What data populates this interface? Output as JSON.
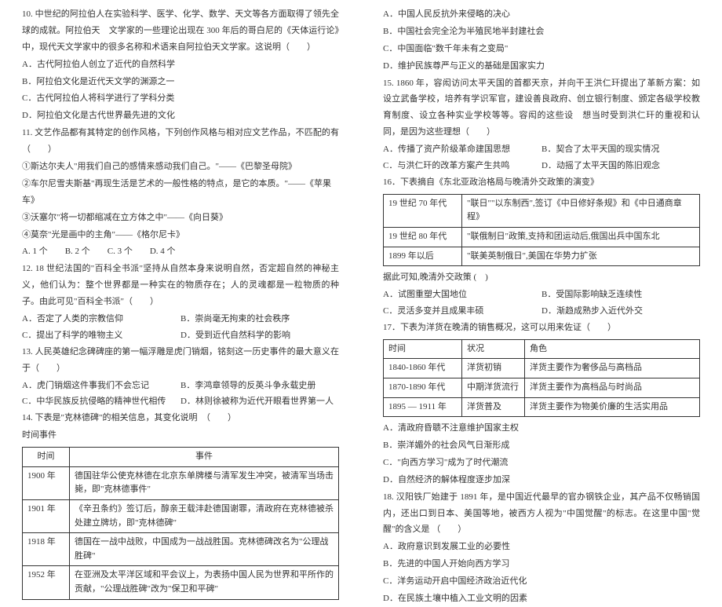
{
  "left": {
    "q10": {
      "stem": "10. 中世纪的阿拉伯人在实验科学、医学、化学、数学、天文等各方面取得了领先全球的成就。阿拉伯天　文学家的一些理论出现在 300 年后的哥白尼的《天体运行论》中，现代天文学家中的很多名称和术语来自阿拉伯天文学家。这说明（　　）",
      "a": "A．古代阿拉伯人创立了近代的自然科学",
      "b": "B．阿拉伯文化是近代天文学的渊源之一",
      "c": "C．古代阿拉伯人将科学进行了学科分类",
      "d": "D．阿拉伯文化是古代世界最先进的文化"
    },
    "q11": {
      "stem": "11. 文艺作品都有其特定的创作风格，下列创作风格与相对应文艺作品，不匹配的有（　　）",
      "i1": "①斯达尔夫人\"用我们自己的感情来感动我们自己。\"——《巴黎圣母院》",
      "i2": "②车尔尼雪夫斯基\"再现生活是艺术的一般性格的特点，是它的本质。\"——《苹果车》",
      "i3": "③沃塞尔\"将一切都缩减在立方体之中\"——《向日葵》",
      "i4": "④莫奈\"光是画中的主角\"——《格尔尼卡》",
      "choices": "A. 1 个　　B. 2 个　　C. 3 个　　D. 4 个"
    },
    "q12": {
      "stem": "12. 18 世纪法国的\"百科全书派\"坚持从自然本身来说明自然，否定超自然的神秘主义，他们认为：整个世界都是一种实在的物质存在；人的灵魂都是一粒物质的种子。由此可见\"百科全书派\"（　　）",
      "a": "A．否定了人类的宗教信仰",
      "b": "B．崇尚毫无拘束的社会秩序",
      "c": "C．提出了科学的唯物主义",
      "d": "D．受到近代自然科学的影响"
    },
    "q13": {
      "stem": "13. 人民英雄纪念碑碑座的第一幅浮雕是虎门销烟，铭刻这一历史事件的最大意义在于（　　）",
      "a": "A．虎门销烟这件事我们不会忘记",
      "b": "B．李鸿章领导的反英斗争永载史册",
      "c": "C．中华民族反抗侵略的精神世代相传",
      "d": "D．林则徐被称为近代开眼看世界第一人"
    },
    "q14": {
      "stem": "14. 下表是\"克林德碑\"的相关信息，其变化说明　（　　）",
      "pre": "时间事件",
      "table": {
        "head": [
          "时间",
          "事件"
        ],
        "rows": [
          [
            "1900 年",
            "德国驻华公使克林德在北京东单牌楼与清军发生冲突，被清军当场击毙，即\"克林德事件\""
          ],
          [
            "1901 年",
            "《辛丑条约》签订后，醇亲王载沣赴德国谢罪，清政府在克林德被杀处建立牌坊，即\"克林德碑\""
          ],
          [
            "1918 年",
            "德国在一战中战败，中国成为一战战胜国。克林德碑改名为\"公理战胜碑\""
          ],
          [
            "1952 年",
            "在亚洲及太平洋区域和平会议上，为表扬中国人民为世界和平所作的贡献，\"公理战胜碑\"改为\"保卫和平碑\""
          ]
        ]
      }
    }
  },
  "right": {
    "q14_choices": {
      "a": "A．中国人民反抗外来侵略的决心",
      "b": "B．中国社会完全沦为半殖民地半封建社会",
      "c": "C．中国面临\"数千年未有之变局\"",
      "d": "D．维护民族尊严与正义的基础是国家实力"
    },
    "q15": {
      "stem": "15. 1860 年，容闳访问太平天国的首都天京，并向干王洪仁玕提出了革新方案：如设立武备学校，培养有学识军官，建设善良政府、创立银行制度、颁定各级学校教育制度、设立各种实业学校等等。容闳的这些设　想当时受到洪仁玕的重视和认同，是因为这些理想（　　）",
      "a": "A．传播了资产阶级革命建国思想",
      "b": "B．契合了太平天国的现实情况",
      "c": "C．与洪仁玕的改革方案产生共鸣",
      "d": "D．动摇了太平天国的陈旧观念"
    },
    "q16": {
      "stem": "16．下表摘自《东北亚政治格局与晚清外交政策的演变》",
      "table": {
        "rows": [
          [
            "19 世纪 70 年代",
            "\"联日\"\"以东制西\",签订《中日修好条规》和《中日通商章程》"
          ],
          [
            "19 世纪 80 年代",
            "\"联俄制日\"政策,支持和团运动后,俄国出兵中国东北"
          ],
          [
            "1899 年以后",
            "\"联美英制俄日\",美国在华势力扩张"
          ]
        ]
      },
      "post": "据此可知,晚清外交政策 (　)",
      "a": "A．试图重塑大国地位",
      "b": "B．受国际影响缺乏连续性",
      "c": "C．灵活多变并且成果丰硕",
      "d": "D．渐趋成熟步入近代外交"
    },
    "q17": {
      "stem": "17．下表为洋货在晚清的销售概况，这可以用来佐证（　　）",
      "table": {
        "head": [
          "时间",
          "状况",
          "角色"
        ],
        "rows": [
          [
            "1840-1860 年代",
            "洋货初销",
            "洋货主要作为奢侈品与高档品"
          ],
          [
            "1870-1890 年代",
            "中期洋货流行",
            "洋货主要作为高档品与时尚品"
          ],
          [
            "1895 — 1911 年",
            "洋货普及",
            "洋货主要作为物美价廉的生活实用品"
          ]
        ]
      },
      "a": "A．清政府昏聩不注意维护国家主权",
      "b": "B．崇洋媚外的社会风气日渐形成",
      "c": "C．\"向西方学习\"成为了时代潮流",
      "d": "D．自然经济的解体程度逐步加深"
    },
    "q18": {
      "stem": "18. 汉阳铁厂始建于 1891 年，是中国近代最早的官办钢铁企业，其产品不仅畅销国内，还出口到日本、美国等地，被西方人视为\"中国觉醒\"的标志。在这里中国\"觉醒\"的含义是 （　　）",
      "a": "A．政府意识到发展工业的必要性",
      "b": "B．先进的中国人开始向西方学习",
      "c": "C．洋务运动开启中国经济政治近代化",
      "d": "D．在民族土壤中植入工业文明的因素"
    }
  }
}
